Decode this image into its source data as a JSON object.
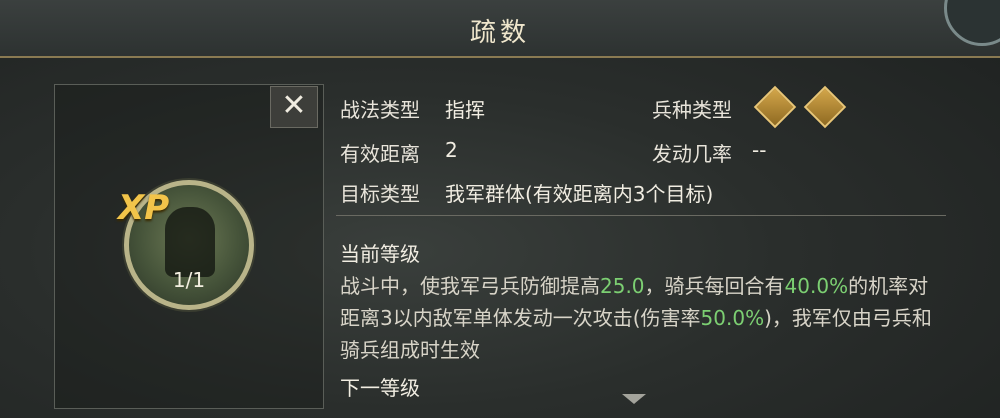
{
  "header": {
    "title": "疏数"
  },
  "skill_card": {
    "close_label": "✕",
    "badge_text": "XP",
    "level": "1/1"
  },
  "info": {
    "type_label": "战法类型",
    "type_value": "指挥",
    "unit_label": "兵种类型",
    "range_label": "有效距离",
    "range_value": "2",
    "chance_label": "发动几率",
    "chance_value": "--",
    "target_label": "目标类型",
    "target_value": "我军群体(有效距离内3个目标)",
    "unit_icons": [
      "bow-unit-icon",
      "cavalry-unit-icon"
    ]
  },
  "levels": {
    "current_title": "当前等级",
    "current_desc_parts": [
      "战斗中，使我军弓兵防御提高",
      "25.0",
      "，骑兵每回合有",
      "40.0%",
      "的机率对距离3以内敌军单体发动一次攻击(伤害率",
      "50.0%",
      ")，我军仅由弓兵和骑兵组成时生效"
    ],
    "next_title": "下一等级"
  },
  "colors": {
    "highlight": "#7ccf72",
    "gold": "#d3a64a"
  }
}
